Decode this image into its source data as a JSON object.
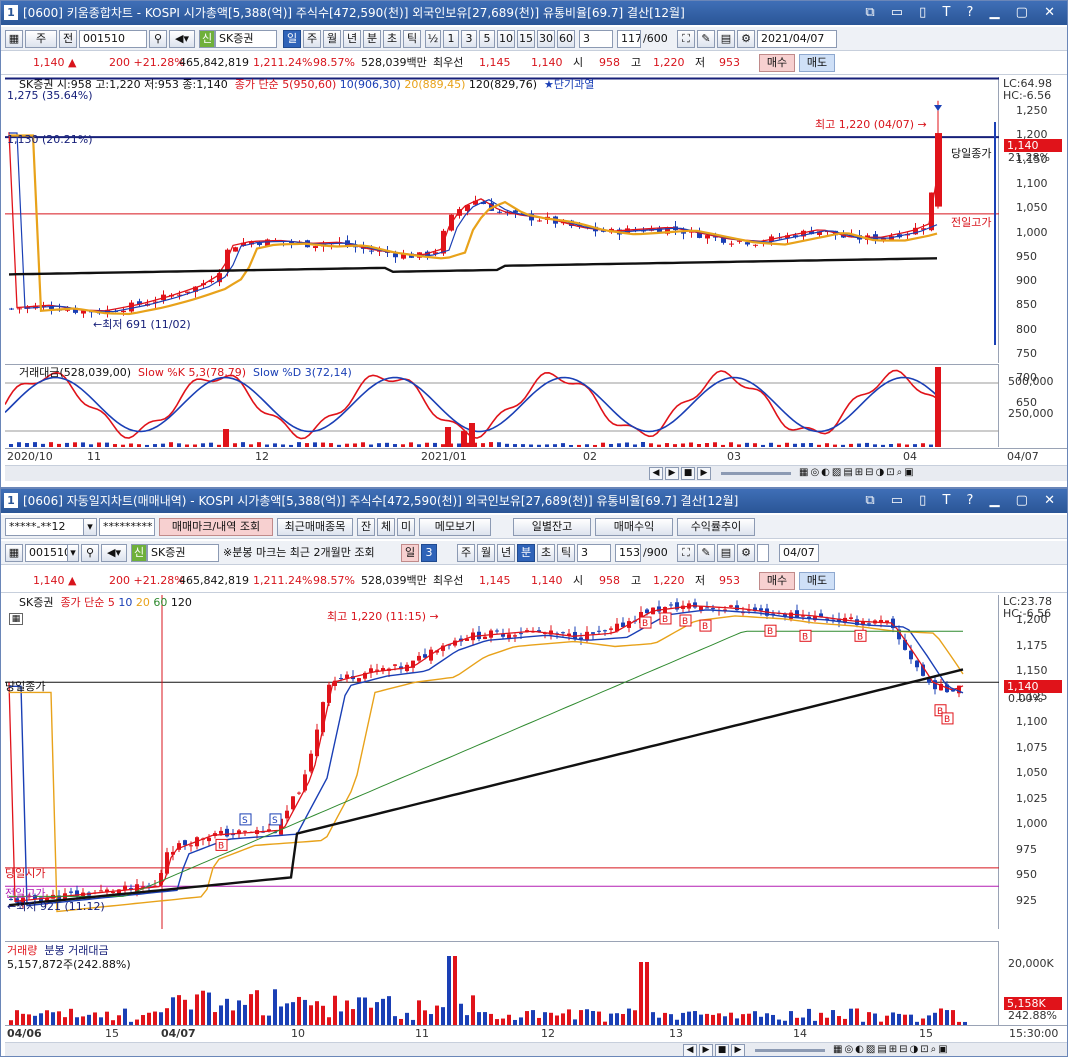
{
  "top": {
    "title": "[0600] 키움종합차트 - KOSPI 시가총액[5,388(억)] 주식수[472,590(천)] 외국인보유[27,689(천)] 유통비율[69.7] 결산[12월]",
    "title_num": "1",
    "toolbar": {
      "market": "주",
      "prev": "전",
      "code": "001510",
      "search_icon": "search-icon",
      "name": "SK증권",
      "sin_badge": "신",
      "periods": [
        "일",
        "주",
        "월",
        "년",
        "분",
        "초",
        "틱"
      ],
      "half": "½",
      "intervals": [
        "1",
        "3",
        "5",
        "10",
        "15",
        "30",
        "60"
      ],
      "interval_sel": "3",
      "count": "117",
      "count_total": "/600",
      "date": "2021/04/07"
    },
    "quote": {
      "price": "1,140",
      "change": "200 +21.28%",
      "volume": "465,842,819",
      "vol_pct": "1,211.24%",
      "ratio": "98.57%",
      "amount": "528,039백만",
      "bid_label": "최우선",
      "bid1": "1,145",
      "bid2": "1,140",
      "open_label": "시",
      "open": "958",
      "high_label": "고",
      "high": "1,220",
      "low_label": "저",
      "low": "953",
      "buy": "매수",
      "sell": "매도"
    },
    "legend": {
      "ohlc": "SK증권 시:958 고:1,220 저:953 종:1,140",
      "ma_title": "종가 단순",
      "ma5": "5(950,60)",
      "ma10": "10(906,30)",
      "ma20": "20(889,45)",
      "ma120": "120(829,76)",
      "signal": "★단기과열",
      "lc": "LC:64.98",
      "hc": "HC:-6.56"
    },
    "annotations": {
      "line1": "1,275 (35.64%)",
      "line2": "1,130 (20.21%)",
      "high": "최고 1,220 (04/07) →",
      "low": "←최저 691 (11/02)",
      "today_close": "당일종가",
      "prev_high": "전일고가",
      "price_tag": "1,140",
      "pct_tag": "21.28%"
    },
    "y_ticks": [
      "1,250",
      "1,200",
      "1,150",
      "1,100",
      "1,050",
      "1,000",
      "950",
      "900",
      "850",
      "800",
      "750",
      "700",
      "650"
    ],
    "sub_legend": {
      "vol": "거래대금(528,039,00)",
      "k": "Slow %K 5,3(78,79)",
      "d": "Slow %D 3(72,14)"
    },
    "sub_ticks": [
      "500,000",
      "250,000"
    ],
    "x_labels": [
      "2020/10",
      "11",
      "12",
      "2021/01",
      "02",
      "03",
      "04",
      "04/07"
    ]
  },
  "bottom": {
    "title": "[0606] 자동일지차트(매매내역) - KOSPI 시가총액[5,388(억)] 주식수[472,590(천)] 외국인보유[27,689(천)] 유통비율[69.7] 결산[12월]",
    "title_num": "1",
    "toolbar1": {
      "account": "*****-**12",
      "password": "*********",
      "b_mark": "매매마크/내역 조회",
      "b_recent": "최근매매종목",
      "b_jan": "잔",
      "b_che": "체",
      "b_mi": "미",
      "b_memo": "메모보기",
      "b_daily": "일별잔고",
      "b_profit": "매매수익",
      "b_rate": "수익률추이"
    },
    "toolbar2": {
      "code": "001510",
      "name": "SK증권",
      "sin_badge": "신",
      "notice": "※분봉 마크는 최근 2개월만 조회",
      "period_day": "일",
      "period_sel": "3",
      "periods": [
        "주",
        "월",
        "년",
        "분",
        "초",
        "틱"
      ],
      "interval": "3",
      "count": "153",
      "count_total": "/900",
      "date": "04/07"
    },
    "quote": {
      "price": "1,140",
      "change": "200 +21.28%",
      "volume": "465,842,819",
      "vol_pct": "1,211.24%",
      "ratio": "98.57%",
      "amount": "528,039백만",
      "bid_label": "최우선",
      "bid1": "1,145",
      "bid2": "1,140",
      "open_label": "시",
      "open": "958",
      "high_label": "고",
      "high": "1,220",
      "low_label": "저",
      "low": "953",
      "buy": "매수",
      "sell": "매도"
    },
    "legend": {
      "name": "SK증권",
      "ma_title": "종가 단순",
      "ma5": "5",
      "ma10": "10",
      "ma20": "20",
      "ma60": "60",
      "ma120": "120",
      "lc": "LC:23.78",
      "hc": "HC:-6.56"
    },
    "annotations": {
      "high": "최고 1,220 (11:15) →",
      "low": "←최저 921 (11:12)",
      "today_close": "당일종가",
      "today_open": "당일시가",
      "prev_high": "전일고가",
      "price_tag": "1,140",
      "pct_tag": "0.00%"
    },
    "y_ticks": [
      "1,200",
      "1,175",
      "1,150",
      "1,125",
      "1,100",
      "1,075",
      "1,050",
      "1,025",
      "1,000",
      "975",
      "950",
      "925"
    ],
    "sub_legend": {
      "vol": "거래량",
      "amount": "분봉 거래대금",
      "value": "5,157,872주(242.88%)"
    },
    "sub_ticks": [
      "20,000K"
    ],
    "sub_tag": "5,158K",
    "sub_pct": "242.88%",
    "x_labels": [
      "04/06",
      "15",
      "04/07",
      "10",
      "11",
      "12",
      "13",
      "14",
      "15",
      "15:30:00"
    ]
  },
  "colors": {
    "up": "#e0131a",
    "down": "#1a3fb5",
    "ma5": "#e0131a",
    "ma10": "#1a3fb5",
    "ma20": "#e8a21a",
    "ma60": "#2f8a2f",
    "ma120": "#111111",
    "title": "#2a5596"
  }
}
